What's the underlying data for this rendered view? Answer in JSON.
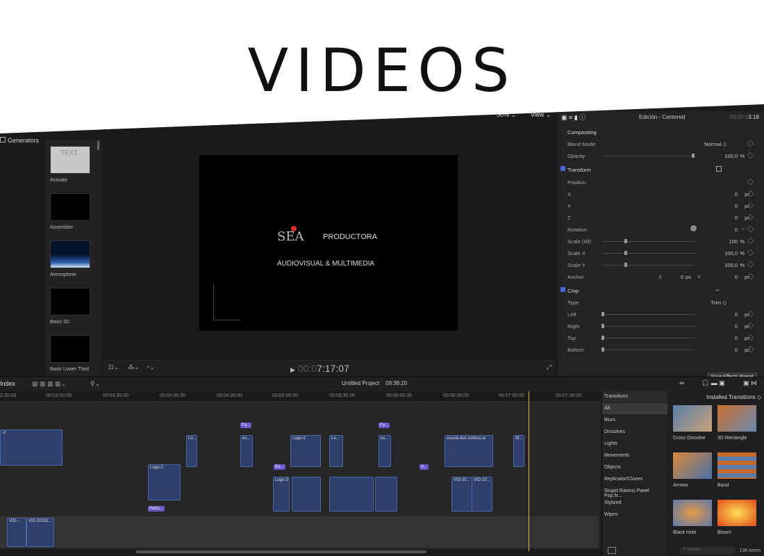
{
  "headline": "VIDEOS",
  "browser": {
    "section_title": "Generators",
    "items": [
      {
        "label": "Activate"
      },
      {
        "label": "Assembler"
      },
      {
        "label": "Atmosphere"
      },
      {
        "label": "Basic 3D"
      },
      {
        "label": "Basic Lower Third"
      }
    ]
  },
  "viewer": {
    "zoom": "50%",
    "view_menu": "View",
    "timecode_dim": "00:0",
    "timecode": "7:17:07",
    "logo_top": "PRODUCTORA",
    "logo_bottom": "AUDIOVISUAL & MULTIMEDIA",
    "logo_mark": "SEA"
  },
  "inspector": {
    "title": "Edición - Centered",
    "time_dim": "00:00:0",
    "time": "3:18",
    "rows": {
      "compositing": "Compositing",
      "blend_mode": "Blend Mode",
      "blend_value": "Normal ◇",
      "opacity": "Opacity",
      "opacity_val": "100,0",
      "transform": "Transform",
      "position": "Position",
      "x": "X",
      "y": "Y",
      "z": "Z",
      "rotation": "Rotation",
      "scale_all": "Scale (All)",
      "scale_x": "Scale X",
      "scale_y": "Scale Y",
      "anchor": "Anchor",
      "crop": "Crop",
      "type": "Type",
      "type_val": "Trim ◇",
      "left": "Left",
      "right": "Right",
      "top": "Top",
      "bottom": "Bottom",
      "zero": "0",
      "hundred": "100",
      "hundred_dec": "100,0",
      "px": "px",
      "pct": "%",
      "deg": "°",
      "anchor_x": "X",
      "anchor_y": "Y"
    },
    "save_preset": "Save Effects Preset"
  },
  "timeline": {
    "index": "Index",
    "project": "Untitled Project",
    "duration": "09:38:20",
    "ruler": [
      "2:30:00",
      "00:03:00:00",
      "00:03:30:00",
      "00:04:00:00",
      "00:04:30:00",
      "00:05:00:00",
      "00:05:30:00",
      "00:06:00:00",
      "00:06:30:00",
      "00:07:00:00",
      "00:07:30:00"
    ],
    "clips": {
      "logo2a": "Logo-2",
      "logo2b": "Logo-2",
      "logo2c": "Logo-2",
      "lo": "Lo...",
      "escola": "escola dos sonhos.ai",
      "vid": "VID-20...",
      "vid2": "VID-20...",
      "storyline1": "VID-...",
      "storyline2": "VID-20191...",
      "patric": "Patric...",
      "fa": "Fa...",
      "es": "es...",
      "ra": "Ra...",
      "a": "A...",
      "w": "W...",
      "two": "-2"
    }
  },
  "transitions": {
    "header": "Transitions",
    "title": "Installed Transitions ◇",
    "categories": [
      "All",
      "Blurs",
      "Dissolves",
      "Lights",
      "Movements",
      "Objects",
      "Replicator/Clones",
      "Stupid Raisins Panel Pop.fx...",
      "Stylized",
      "Wipes"
    ],
    "items": [
      {
        "label": "Cross Dissolve"
      },
      {
        "label": "3D Rectangle"
      },
      {
        "label": "Arrows"
      },
      {
        "label": "Band"
      },
      {
        "label": "Black Hole"
      },
      {
        "label": "Bloom"
      }
    ],
    "search_placeholder": "Search",
    "count": "136 items"
  },
  "colors": {
    "accent": "#4a66d8",
    "clip": "#2d3f6a",
    "playhead": "#e8b43a",
    "compound": "#6b58c9"
  }
}
